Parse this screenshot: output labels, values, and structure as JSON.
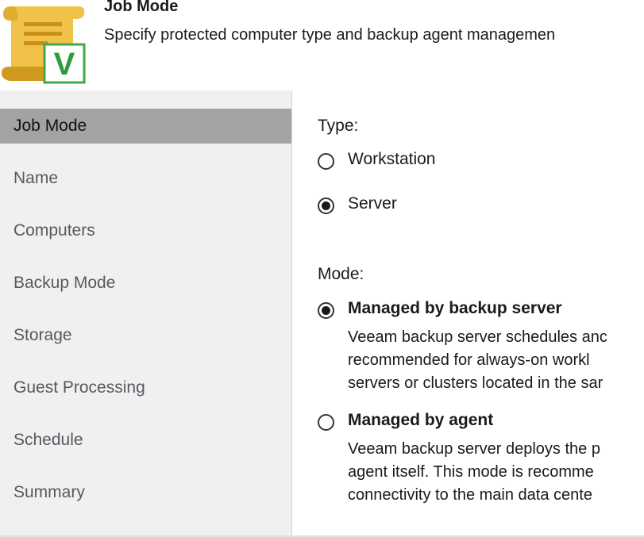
{
  "header": {
    "title": "Job Mode",
    "subtitle": "Specify protected computer type and backup agent managemen",
    "icon": "scroll-checkmark-icon",
    "icon_letter": "V",
    "colors": {
      "scroll": "#f0c24a",
      "scroll_dark": "#d19a1e",
      "check_border": "#3faa48",
      "check_letter": "#2e9a3a"
    }
  },
  "sidebar": {
    "items": [
      {
        "label": "Job Mode",
        "active": true
      },
      {
        "label": "Name",
        "active": false
      },
      {
        "label": "Computers",
        "active": false
      },
      {
        "label": "Backup Mode",
        "active": false
      },
      {
        "label": "Storage",
        "active": false
      },
      {
        "label": "Guest Processing",
        "active": false
      },
      {
        "label": "Schedule",
        "active": false
      },
      {
        "label": "Summary",
        "active": false
      }
    ]
  },
  "main": {
    "type_label": "Type:",
    "type_options": [
      {
        "label": "Workstation",
        "checked": false
      },
      {
        "label": "Server",
        "checked": true
      }
    ],
    "mode_label": "Mode:",
    "mode_options": [
      {
        "label": "Managed by backup server",
        "checked": true,
        "description": [
          "Veeam backup server schedules anc",
          "recommended for always-on workl",
          "servers or clusters located in the sar"
        ]
      },
      {
        "label": "Managed by agent",
        "checked": false,
        "description": [
          "Veeam backup server deploys the p",
          "agent itself. This mode is recomme",
          "connectivity to the main data cente"
        ]
      }
    ]
  }
}
